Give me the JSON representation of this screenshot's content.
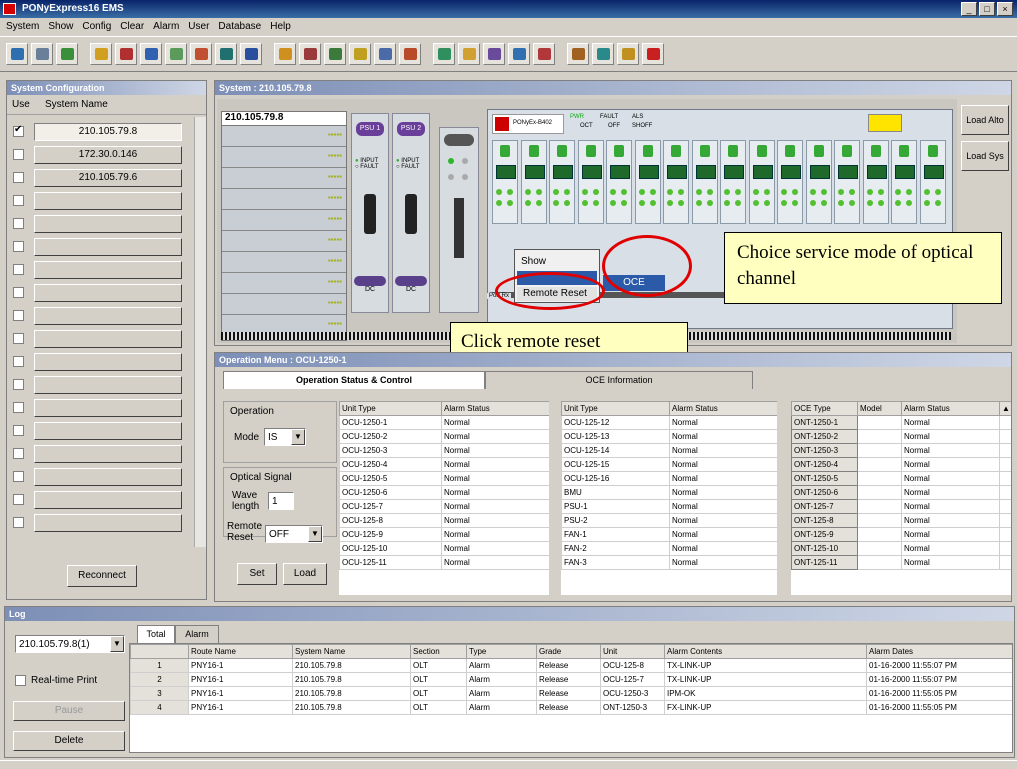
{
  "window": {
    "title": "PONyExpress16 EMS",
    "min": "_",
    "max": "□",
    "close": "×"
  },
  "menu": [
    "System",
    "Show",
    "Config",
    "Clear",
    "Alarm",
    "User",
    "Database",
    "Help"
  ],
  "toolbar_colors": [
    "#2f6fb0",
    "#6a7f99",
    "#3a8f3a",
    "#d2a020",
    "#b03030",
    "#3060b0",
    "#5a9a5a",
    "#c05030",
    "#207070",
    "#2a4f9f",
    "#d09020",
    "#9a3a3a",
    "#3a7a3a",
    "#c0a020",
    "#4a6aa8",
    "#b84a2a",
    "#2f8f5f",
    "#d0a030",
    "#6a4a9a",
    "#3070b0",
    "#b03838",
    "#a06020",
    "#2a8a8a",
    "#c09020",
    "#c82020"
  ],
  "left": {
    "header": "System Configuration",
    "col_use": "Use",
    "col_name": "System Name",
    "systems": [
      {
        "checked": true,
        "name": "210.105.79.8"
      },
      {
        "checked": false,
        "name": "172.30.0.146"
      },
      {
        "checked": false,
        "name": "210.105.79.6"
      },
      {
        "checked": false,
        "name": ""
      },
      {
        "checked": false,
        "name": ""
      },
      {
        "checked": false,
        "name": ""
      },
      {
        "checked": false,
        "name": ""
      },
      {
        "checked": false,
        "name": ""
      },
      {
        "checked": false,
        "name": ""
      },
      {
        "checked": false,
        "name": ""
      },
      {
        "checked": false,
        "name": ""
      },
      {
        "checked": false,
        "name": ""
      },
      {
        "checked": false,
        "name": ""
      },
      {
        "checked": false,
        "name": ""
      },
      {
        "checked": false,
        "name": ""
      },
      {
        "checked": false,
        "name": ""
      },
      {
        "checked": false,
        "name": ""
      },
      {
        "checked": false,
        "name": ""
      }
    ],
    "reconnect": "Reconnect"
  },
  "system": {
    "header": "System : 210.105.79.8",
    "box_title": "210.105.79.8",
    "slot_labels": [
      "▪▪▪▪▪",
      "▪▪▪▪▪",
      "▪▪▪▪▪",
      "▪▪▪▪▪",
      "▪▪▪▪▪",
      "▪▪▪▪▪",
      "▪▪▪▪▪",
      "▪▪▪▪▪",
      "▪▪▪▪▪",
      "▪▪▪▪▪"
    ],
    "psu": [
      "PSU 1",
      "PSU 2"
    ],
    "psu_input": "INPUT",
    "psu_fault": "FAULT",
    "dc": "DC",
    "brand": "PONyEx-B402",
    "leds": [
      "PWR",
      "FAULT",
      "ALS",
      "OCT",
      "OFF",
      "SHOFF"
    ],
    "load_alto": "Load Alto",
    "load_sys": "Load Sys",
    "port_rx": "Port Rx",
    "context_menu": [
      "Show",
      "Remote Reset"
    ],
    "submenu": "OCE"
  },
  "annotations": {
    "choice": "Choice service mode of optical channel",
    "click": "Click remote reset"
  },
  "operation": {
    "header": "Operation Menu : OCU-1250-1",
    "tabs": [
      "Operation Status & Control",
      "OCE Information"
    ],
    "op_group": "Operation",
    "mode_label": "Mode",
    "mode_value": "IS",
    "opt_group": "Optical Signal",
    "wave_label": "Wave length",
    "wave_value": "1",
    "reset_label": "Remote Reset",
    "reset_value": "OFF",
    "set": "Set",
    "load": "Load",
    "t1_head": [
      "Unit Type",
      "Alarm Status"
    ],
    "t1": [
      [
        "OCU-1250-1",
        "Normal"
      ],
      [
        "OCU-1250-2",
        "Normal"
      ],
      [
        "OCU-1250-3",
        "Normal"
      ],
      [
        "OCU-1250-4",
        "Normal"
      ],
      [
        "OCU-1250-5",
        "Normal"
      ],
      [
        "OCU-1250-6",
        "Normal"
      ],
      [
        "OCU-125-7",
        "Normal"
      ],
      [
        "OCU-125-8",
        "Normal"
      ],
      [
        "OCU-125-9",
        "Normal"
      ],
      [
        "OCU-125-10",
        "Normal"
      ],
      [
        "OCU-125-11",
        "Normal"
      ]
    ],
    "t2_head": [
      "Unit Type",
      "Alarm Status"
    ],
    "t2": [
      [
        "OCU-125-12",
        "Normal"
      ],
      [
        "OCU-125-13",
        "Normal"
      ],
      [
        "OCU-125-14",
        "Normal"
      ],
      [
        "OCU-125-15",
        "Normal"
      ],
      [
        "OCU-125-16",
        "Normal"
      ],
      [
        "BMU",
        "Normal"
      ],
      [
        "PSU-1",
        "Normal"
      ],
      [
        "PSU-2",
        "Normal"
      ],
      [
        "FAN-1",
        "Normal"
      ],
      [
        "FAN-2",
        "Normal"
      ],
      [
        "FAN-3",
        "Normal"
      ]
    ],
    "t3_head": [
      "OCE Type",
      "Model",
      "Alarm Status"
    ],
    "t3": [
      [
        "ONT-1250-1",
        "",
        "Normal"
      ],
      [
        "ONT-1250-2",
        "",
        "Normal"
      ],
      [
        "ONT-1250-3",
        "",
        "Normal"
      ],
      [
        "ONT-1250-4",
        "",
        "Normal"
      ],
      [
        "ONT-1250-5",
        "",
        "Normal"
      ],
      [
        "ONT-1250-6",
        "",
        "Normal"
      ],
      [
        "ONT-125-7",
        "",
        "Normal"
      ],
      [
        "ONT-125-8",
        "",
        "Normal"
      ],
      [
        "ONT-125-9",
        "",
        "Normal"
      ],
      [
        "ONT-125-10",
        "",
        "Normal"
      ],
      [
        "ONT-125-11",
        "",
        "Normal"
      ]
    ]
  },
  "log": {
    "header": "Log",
    "combo": "210.105.79.8(1)",
    "tabs": [
      "Total",
      "Alarm"
    ],
    "realtime": "Real-time Print",
    "pause": "Pause",
    "delete": "Delete",
    "columns": [
      "",
      "Route Name",
      "System Name",
      "Section",
      "Type",
      "Grade",
      "Unit",
      "Alarm Contents",
      "Alarm Dates"
    ],
    "rows": [
      [
        "1",
        "PNY16-1",
        "210.105.79.8",
        "OLT",
        "Alarm",
        "Release",
        "OCU-125-8",
        "TX-LINK-UP",
        "01-16-2000 11:55:07 PM"
      ],
      [
        "2",
        "PNY16-1",
        "210.105.79.8",
        "OLT",
        "Alarm",
        "Release",
        "OCU-125-7",
        "TX-LINK-UP",
        "01-16-2000 11:55:07 PM"
      ],
      [
        "3",
        "PNY16-1",
        "210.105.79.8",
        "OLT",
        "Alarm",
        "Release",
        "OCU-1250-3",
        "IPM-OK",
        "01-16-2000 11:55:05 PM"
      ],
      [
        "4",
        "PNY16-1",
        "210.105.79.8",
        "OLT",
        "Alarm",
        "Release",
        "ONT-1250-3",
        "FX-LINK-UP",
        "01-16-2000 11:55:05 PM"
      ]
    ]
  }
}
